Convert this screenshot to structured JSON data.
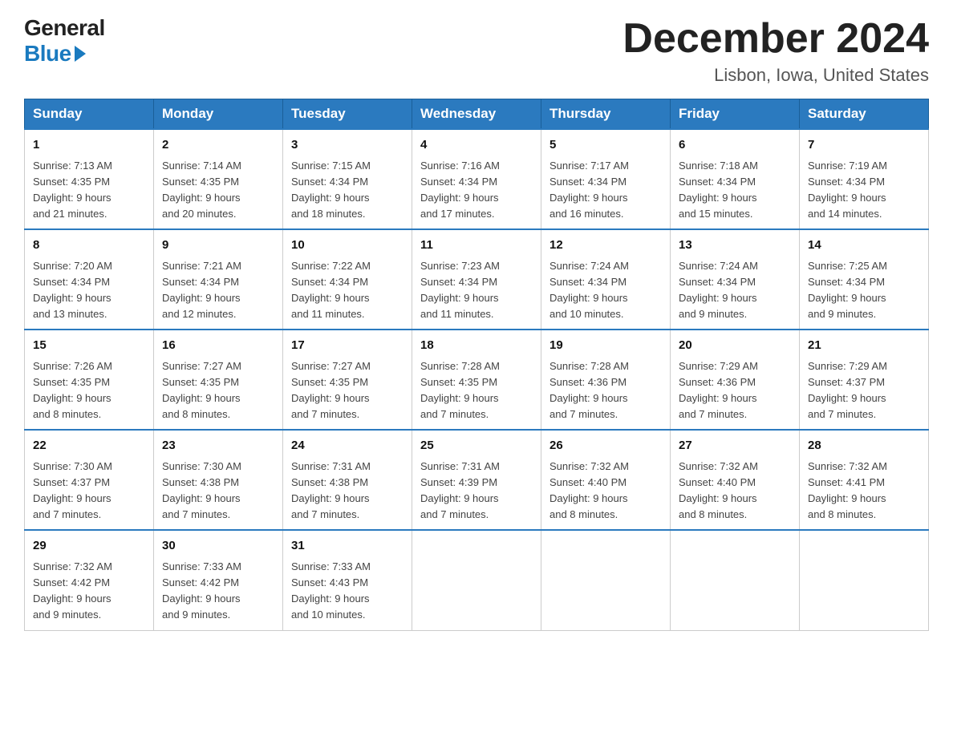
{
  "logo": {
    "general": "General",
    "blue": "Blue"
  },
  "title": "December 2024",
  "location": "Lisbon, Iowa, United States",
  "headers": [
    "Sunday",
    "Monday",
    "Tuesday",
    "Wednesday",
    "Thursday",
    "Friday",
    "Saturday"
  ],
  "weeks": [
    [
      {
        "day": "1",
        "sunrise": "7:13 AM",
        "sunset": "4:35 PM",
        "daylight": "9 hours and 21 minutes."
      },
      {
        "day": "2",
        "sunrise": "7:14 AM",
        "sunset": "4:35 PM",
        "daylight": "9 hours and 20 minutes."
      },
      {
        "day": "3",
        "sunrise": "7:15 AM",
        "sunset": "4:34 PM",
        "daylight": "9 hours and 18 minutes."
      },
      {
        "day": "4",
        "sunrise": "7:16 AM",
        "sunset": "4:34 PM",
        "daylight": "9 hours and 17 minutes."
      },
      {
        "day": "5",
        "sunrise": "7:17 AM",
        "sunset": "4:34 PM",
        "daylight": "9 hours and 16 minutes."
      },
      {
        "day": "6",
        "sunrise": "7:18 AM",
        "sunset": "4:34 PM",
        "daylight": "9 hours and 15 minutes."
      },
      {
        "day": "7",
        "sunrise": "7:19 AM",
        "sunset": "4:34 PM",
        "daylight": "9 hours and 14 minutes."
      }
    ],
    [
      {
        "day": "8",
        "sunrise": "7:20 AM",
        "sunset": "4:34 PM",
        "daylight": "9 hours and 13 minutes."
      },
      {
        "day": "9",
        "sunrise": "7:21 AM",
        "sunset": "4:34 PM",
        "daylight": "9 hours and 12 minutes."
      },
      {
        "day": "10",
        "sunrise": "7:22 AM",
        "sunset": "4:34 PM",
        "daylight": "9 hours and 11 minutes."
      },
      {
        "day": "11",
        "sunrise": "7:23 AM",
        "sunset": "4:34 PM",
        "daylight": "9 hours and 11 minutes."
      },
      {
        "day": "12",
        "sunrise": "7:24 AM",
        "sunset": "4:34 PM",
        "daylight": "9 hours and 10 minutes."
      },
      {
        "day": "13",
        "sunrise": "7:24 AM",
        "sunset": "4:34 PM",
        "daylight": "9 hours and 9 minutes."
      },
      {
        "day": "14",
        "sunrise": "7:25 AM",
        "sunset": "4:34 PM",
        "daylight": "9 hours and 9 minutes."
      }
    ],
    [
      {
        "day": "15",
        "sunrise": "7:26 AM",
        "sunset": "4:35 PM",
        "daylight": "9 hours and 8 minutes."
      },
      {
        "day": "16",
        "sunrise": "7:27 AM",
        "sunset": "4:35 PM",
        "daylight": "9 hours and 8 minutes."
      },
      {
        "day": "17",
        "sunrise": "7:27 AM",
        "sunset": "4:35 PM",
        "daylight": "9 hours and 7 minutes."
      },
      {
        "day": "18",
        "sunrise": "7:28 AM",
        "sunset": "4:35 PM",
        "daylight": "9 hours and 7 minutes."
      },
      {
        "day": "19",
        "sunrise": "7:28 AM",
        "sunset": "4:36 PM",
        "daylight": "9 hours and 7 minutes."
      },
      {
        "day": "20",
        "sunrise": "7:29 AM",
        "sunset": "4:36 PM",
        "daylight": "9 hours and 7 minutes."
      },
      {
        "day": "21",
        "sunrise": "7:29 AM",
        "sunset": "4:37 PM",
        "daylight": "9 hours and 7 minutes."
      }
    ],
    [
      {
        "day": "22",
        "sunrise": "7:30 AM",
        "sunset": "4:37 PM",
        "daylight": "9 hours and 7 minutes."
      },
      {
        "day": "23",
        "sunrise": "7:30 AM",
        "sunset": "4:38 PM",
        "daylight": "9 hours and 7 minutes."
      },
      {
        "day": "24",
        "sunrise": "7:31 AM",
        "sunset": "4:38 PM",
        "daylight": "9 hours and 7 minutes."
      },
      {
        "day": "25",
        "sunrise": "7:31 AM",
        "sunset": "4:39 PM",
        "daylight": "9 hours and 7 minutes."
      },
      {
        "day": "26",
        "sunrise": "7:32 AM",
        "sunset": "4:40 PM",
        "daylight": "9 hours and 8 minutes."
      },
      {
        "day": "27",
        "sunrise": "7:32 AM",
        "sunset": "4:40 PM",
        "daylight": "9 hours and 8 minutes."
      },
      {
        "day": "28",
        "sunrise": "7:32 AM",
        "sunset": "4:41 PM",
        "daylight": "9 hours and 8 minutes."
      }
    ],
    [
      {
        "day": "29",
        "sunrise": "7:32 AM",
        "sunset": "4:42 PM",
        "daylight": "9 hours and 9 minutes."
      },
      {
        "day": "30",
        "sunrise": "7:33 AM",
        "sunset": "4:42 PM",
        "daylight": "9 hours and 9 minutes."
      },
      {
        "day": "31",
        "sunrise": "7:33 AM",
        "sunset": "4:43 PM",
        "daylight": "9 hours and 10 minutes."
      },
      null,
      null,
      null,
      null
    ]
  ],
  "labels": {
    "sunrise": "Sunrise: ",
    "sunset": "Sunset: ",
    "daylight": "Daylight: "
  }
}
